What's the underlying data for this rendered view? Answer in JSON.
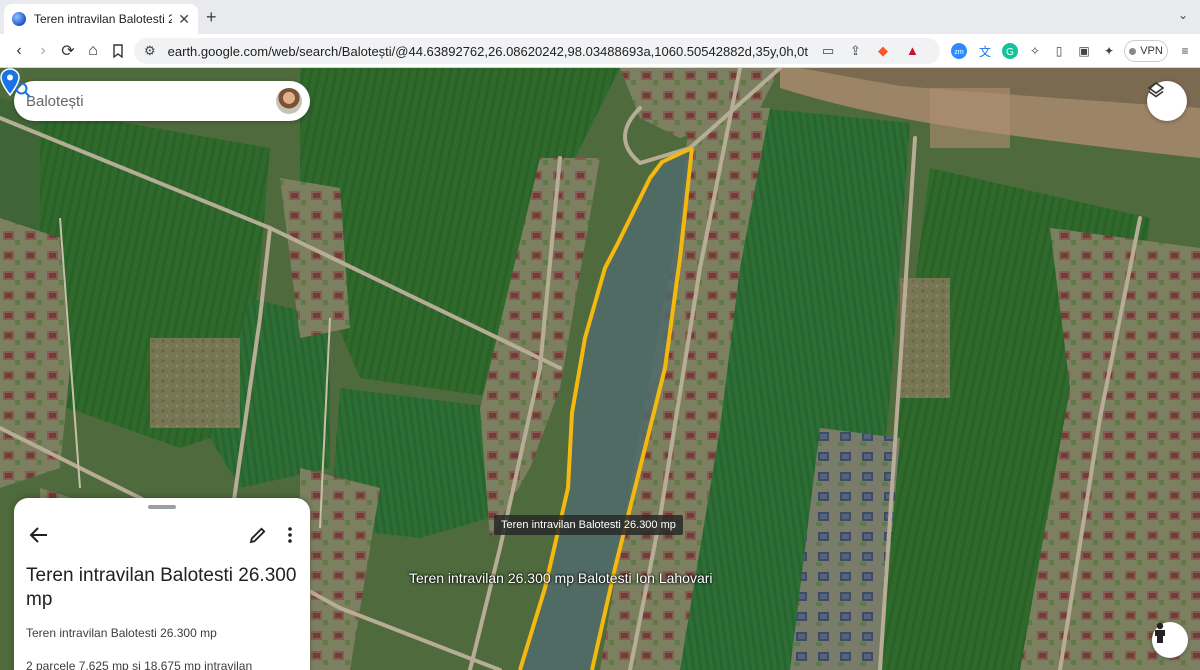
{
  "browser": {
    "tab_title": "Teren intravilan Balotesti 26.3",
    "url": "earth.google.com/web/search/Balotești/@44.63892762,26.08620242,98.03488693a,1060.50542882d,35y,0h,0t...",
    "vpn_label": "VPN"
  },
  "search": {
    "value": "Balotești"
  },
  "map": {
    "tooltip": "Teren intravilan Balotesti 26.300 mp",
    "place_label": "Teren intravilan  26.300 mp Balotesti Ion Lahovari",
    "outline_color": "#f5b80e",
    "pin_color": "#1a73e8"
  },
  "panel": {
    "title": "Teren intravilan Balotesti 26.300 mp",
    "subtitle": "Teren intravilan Balotesti 26.300 mp",
    "description": "2 parcele 7.625 mp și 18.675 mp intravilan"
  }
}
